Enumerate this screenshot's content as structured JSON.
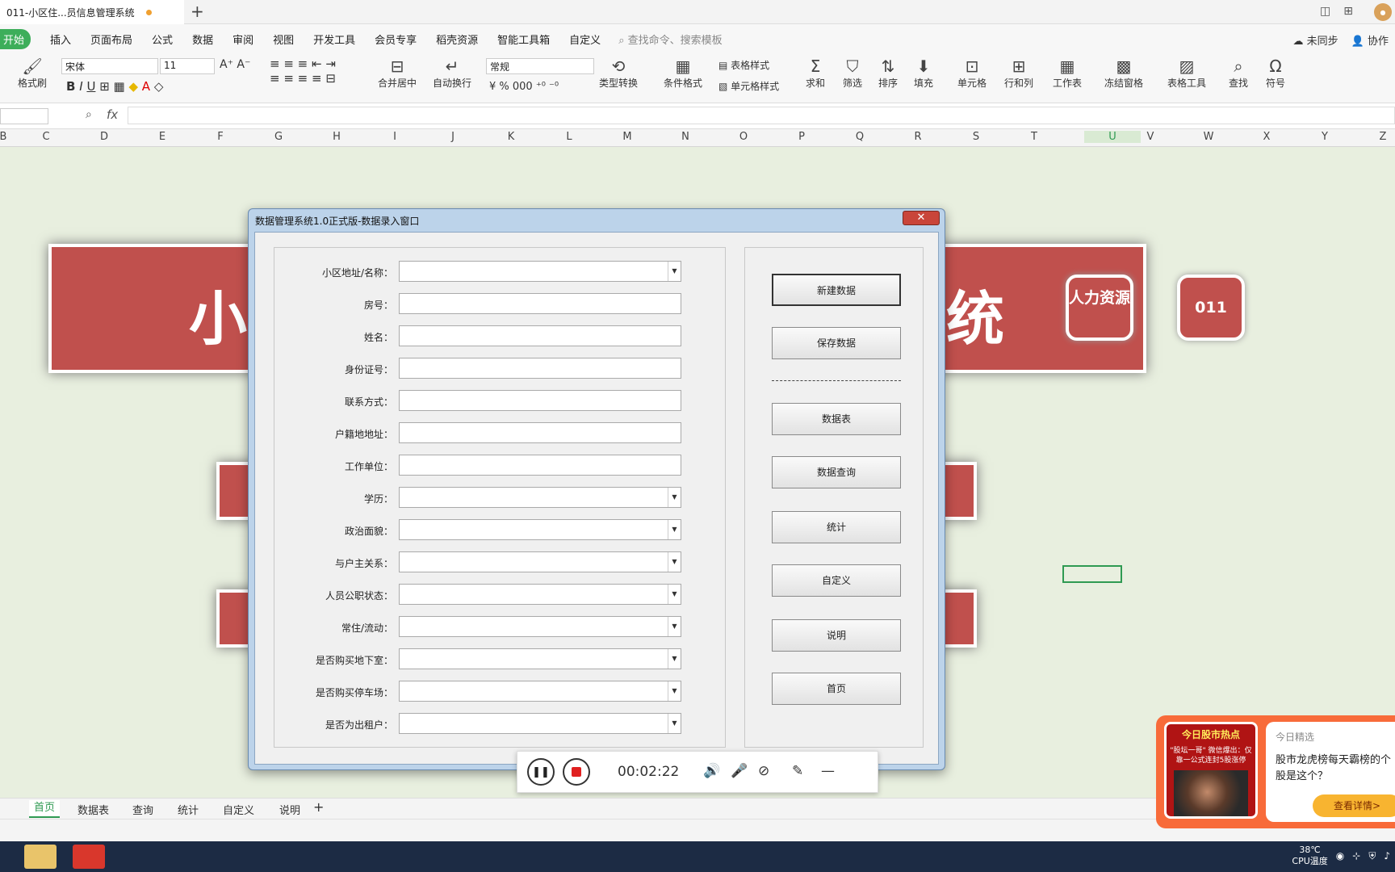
{
  "doc_tab": {
    "title": "011-小区住...员信息管理系统"
  },
  "menubar": {
    "start": "开始",
    "items": [
      "插入",
      "页面布局",
      "公式",
      "数据",
      "审阅",
      "视图",
      "开发工具",
      "会员专享",
      "稻壳资源",
      "智能工具箱",
      "自定义"
    ],
    "search_placeholder": "查找命令、搜索模板",
    "sync": "未同步",
    "collab": "协作"
  },
  "toolbar": {
    "format_brush": "格式刷",
    "font_name": "宋体",
    "font_size": "11",
    "number_format": "常规",
    "merge_center": "合并居中",
    "auto_wrap": "自动换行",
    "type_convert": "类型转换",
    "cond_format": "条件格式",
    "table_style": "表格样式",
    "cell_style": "单元格样式",
    "sum": "求和",
    "filter": "筛选",
    "sort": "排序",
    "fill": "填充",
    "cell": "单元格",
    "rowcol": "行和列",
    "worksheet": "工作表",
    "freeze": "冻结窗格",
    "table_tools": "表格工具",
    "find": "查找",
    "symbol": "符号"
  },
  "formula_bar": {
    "fx": "fx"
  },
  "columns": [
    "B",
    "C",
    "D",
    "E",
    "F",
    "G",
    "H",
    "I",
    "J",
    "K",
    "L",
    "M",
    "N",
    "O",
    "P",
    "Q",
    "R",
    "S",
    "T",
    "U",
    "V",
    "W",
    "X",
    "Y",
    "Z"
  ],
  "sheet_content": {
    "banner_left_char": "小",
    "banner_right_char": "统",
    "badge_hr": "人力资源",
    "badge_no": "011"
  },
  "dialog": {
    "title": "数据管理系统1.0正式版-数据录入窗口",
    "close": "✕",
    "fields": [
      {
        "label": "小区地址/名称：",
        "dropdown": true
      },
      {
        "label": "房号：",
        "dropdown": false
      },
      {
        "label": "姓名：",
        "dropdown": false
      },
      {
        "label": "身份证号：",
        "dropdown": false
      },
      {
        "label": "联系方式：",
        "dropdown": false
      },
      {
        "label": "户籍地地址：",
        "dropdown": false
      },
      {
        "label": "工作单位：",
        "dropdown": false
      },
      {
        "label": "学历：",
        "dropdown": true
      },
      {
        "label": "政治面貌：",
        "dropdown": true
      },
      {
        "label": "与户主关系：",
        "dropdown": true
      },
      {
        "label": "人员公职状态：",
        "dropdown": true
      },
      {
        "label": "常住/流动：",
        "dropdown": true
      },
      {
        "label": "是否购买地下室：",
        "dropdown": true
      },
      {
        "label": "是否购买停车场：",
        "dropdown": true
      },
      {
        "label": "是否为出租户：",
        "dropdown": true
      }
    ],
    "buttons": {
      "new": "新建数据",
      "save": "保存数据",
      "sheet": "数据表",
      "query": "数据查询",
      "stats": "统计",
      "custom": "自定义",
      "help": "说明",
      "home": "首页"
    }
  },
  "recorder": {
    "time": "00:02:22"
  },
  "sheet_tabs": [
    "首页",
    "数据表",
    "查询",
    "统计",
    "自定义",
    "说明"
  ],
  "ad": {
    "left_title": "今日股市热点",
    "left_sub": "\"股坛一哥\" 微信爆出：仅靠一公式连封5股涨停",
    "source": "今日精选",
    "text": "股市龙虎榜每天霸榜的个股是这个？",
    "button": "查看详情>"
  },
  "tray": {
    "temp": "38℃",
    "temp_label": "CPU温度"
  }
}
